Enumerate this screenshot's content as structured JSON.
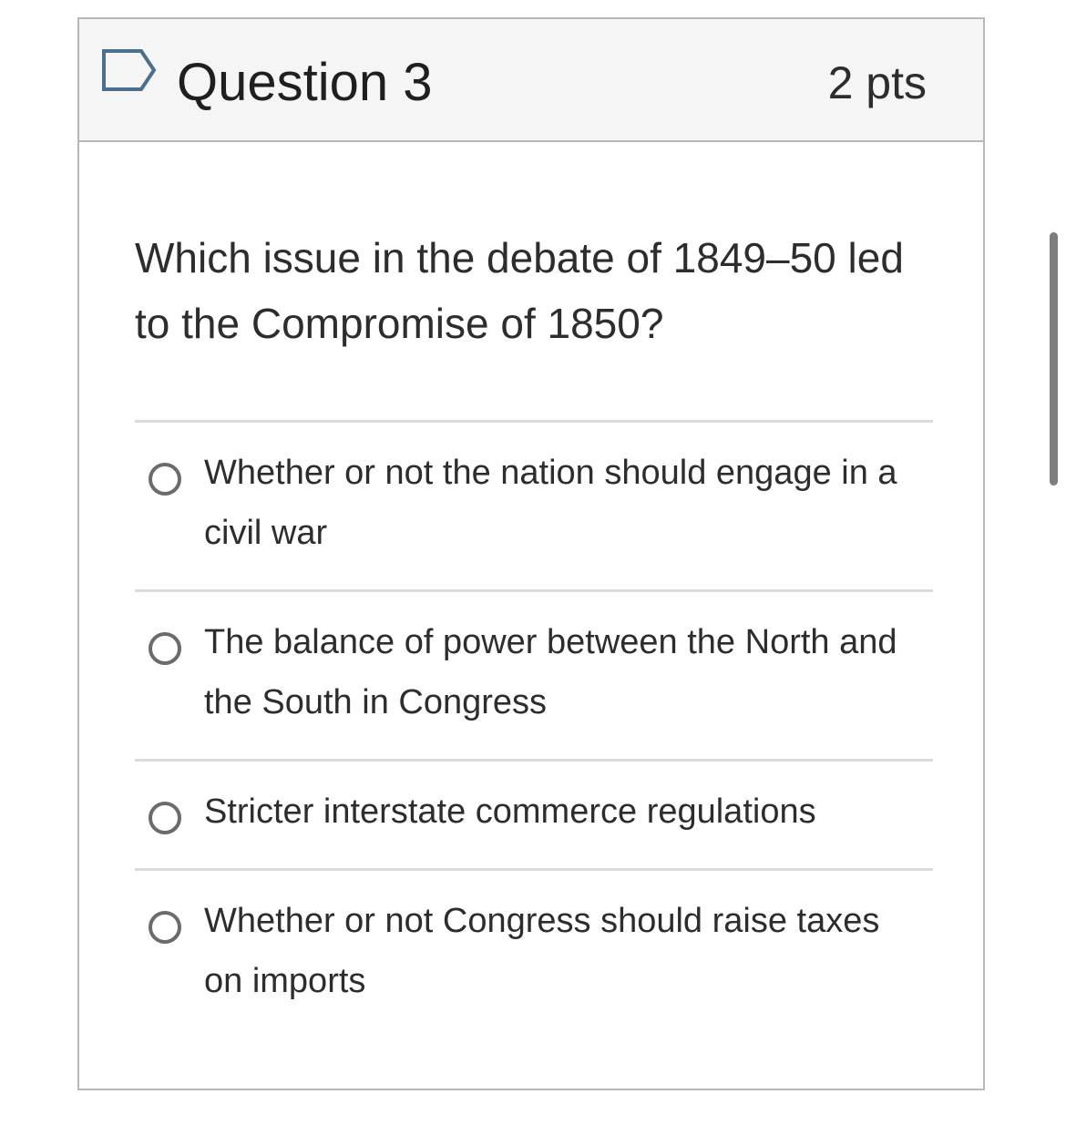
{
  "question": {
    "title": "Question 3",
    "points": "2 pts",
    "flag_icon": "flag-outline-icon",
    "text": "Which issue in the debate of 1849–50 led to the Compromise of 1850?"
  },
  "answers": [
    {
      "label": "Whether or not the nation should engage in a civil war",
      "selected": false
    },
    {
      "label": "The balance of power between the North and the South in Congress",
      "selected": false
    },
    {
      "label": "Stricter interstate commerce regulations",
      "selected": false
    },
    {
      "label": "Whether or not Congress should raise taxes on imports",
      "selected": false
    }
  ],
  "colors": {
    "header_bg": "#f5f5f5",
    "border": "#b8b8b8",
    "flag_stroke": "#4a6f8f",
    "radio_stroke": "#6b6b6b",
    "divider": "#dcdcdc",
    "text": "#2d2d2d"
  }
}
